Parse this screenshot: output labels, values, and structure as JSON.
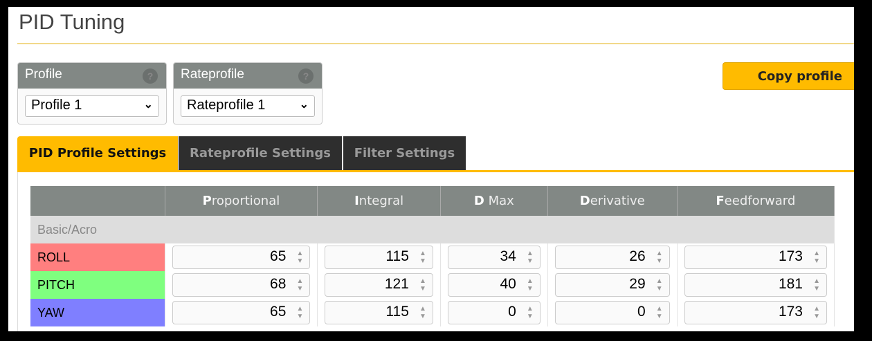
{
  "title": "PID Tuning",
  "profile": {
    "label": "Profile",
    "value": "Profile 1"
  },
  "rateprofile": {
    "label": "Rateprofile",
    "value": "Rateprofile 1"
  },
  "copy_button": "Copy profile",
  "tabs": [
    "PID Profile Settings",
    "Rateprofile Settings",
    "Filter Settings"
  ],
  "table": {
    "headers": [
      {
        "first": "P",
        "rest": "roportional"
      },
      {
        "first": "I",
        "rest": "ntegral"
      },
      {
        "first": "D",
        "rest": " Max"
      },
      {
        "first": "D",
        "rest": "erivative"
      },
      {
        "first": "F",
        "rest": "eedforward"
      }
    ],
    "section": "Basic/Acro",
    "rows": [
      {
        "axis": "ROLL",
        "color": "#ff7f7f",
        "values": [
          "65",
          "115",
          "34",
          "26",
          "173"
        ]
      },
      {
        "axis": "PITCH",
        "color": "#7fff7f",
        "values": [
          "68",
          "121",
          "40",
          "29",
          "181"
        ]
      },
      {
        "axis": "YAW",
        "color": "#7f7fff",
        "values": [
          "65",
          "115",
          "0",
          "0",
          "173"
        ]
      }
    ]
  }
}
